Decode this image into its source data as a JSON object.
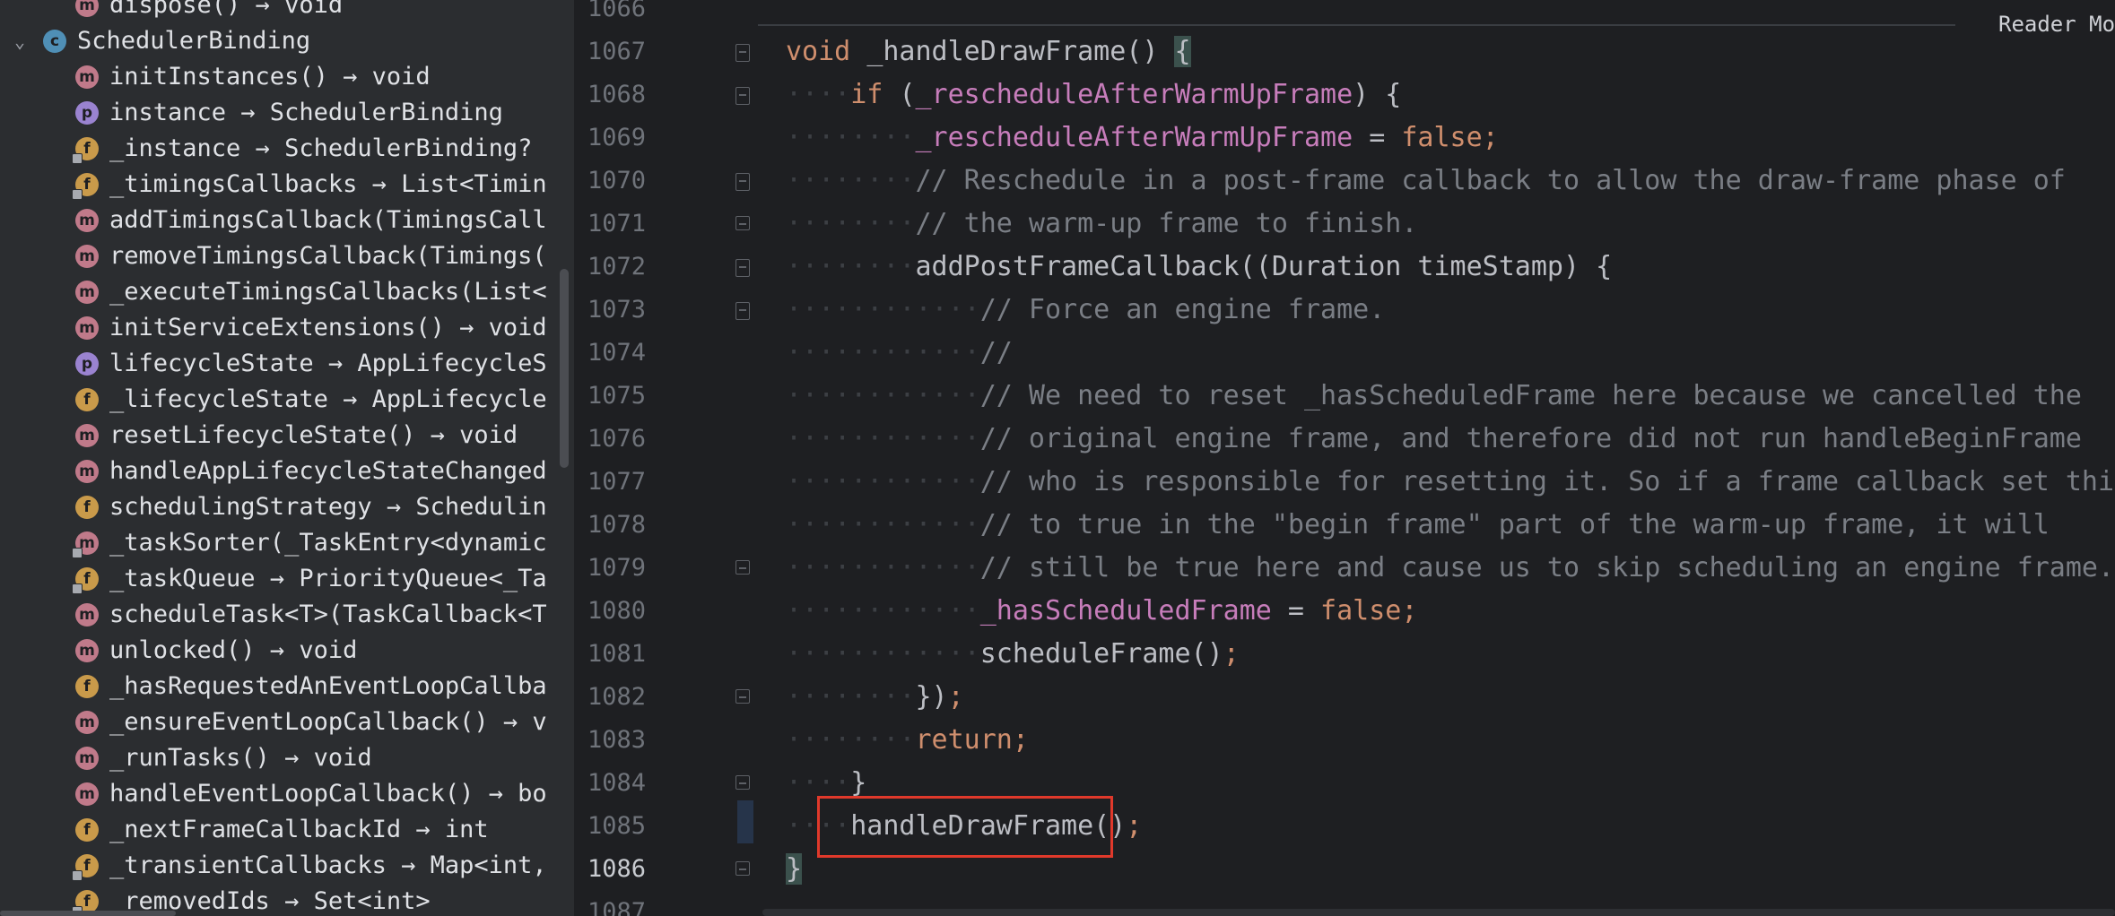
{
  "structure": {
    "rows": [
      {
        "kind": "m",
        "lock": false,
        "label": "dispose() → void"
      },
      {
        "kind": "c",
        "lock": false,
        "label": "SchedulerBinding",
        "expanded": true
      },
      {
        "kind": "m",
        "lock": false,
        "label": "initInstances() → void"
      },
      {
        "kind": "p",
        "lock": false,
        "label": "instance → SchedulerBinding"
      },
      {
        "kind": "f",
        "lock": true,
        "label": "_instance → SchedulerBinding?"
      },
      {
        "kind": "f",
        "lock": true,
        "label": "_timingsCallbacks → List<Timin"
      },
      {
        "kind": "m",
        "lock": false,
        "label": "addTimingsCallback(TimingsCall"
      },
      {
        "kind": "m",
        "lock": false,
        "label": "removeTimingsCallback(Timings("
      },
      {
        "kind": "m",
        "lock": false,
        "label": "_executeTimingsCallbacks(List<"
      },
      {
        "kind": "m",
        "lock": false,
        "label": "initServiceExtensions() → void"
      },
      {
        "kind": "p",
        "lock": false,
        "label": "lifecycleState → AppLifecycleS"
      },
      {
        "kind": "f",
        "lock": false,
        "label": "_lifecycleState → AppLifecycle"
      },
      {
        "kind": "m",
        "lock": false,
        "label": "resetLifecycleState() → void"
      },
      {
        "kind": "m",
        "lock": false,
        "label": "handleAppLifecycleStateChanged"
      },
      {
        "kind": "f",
        "lock": false,
        "label": "schedulingStrategy → Schedulin"
      },
      {
        "kind": "m",
        "lock": true,
        "label": "_taskSorter(_TaskEntry<dynamic"
      },
      {
        "kind": "f",
        "lock": true,
        "label": "_taskQueue → PriorityQueue<_Ta"
      },
      {
        "kind": "m",
        "lock": false,
        "label": "scheduleTask<T>(TaskCallback<T"
      },
      {
        "kind": "m",
        "lock": false,
        "label": "unlocked() → void"
      },
      {
        "kind": "f",
        "lock": false,
        "label": "_hasRequestedAnEventLoopCallba"
      },
      {
        "kind": "m",
        "lock": false,
        "label": "_ensureEventLoopCallback() → v"
      },
      {
        "kind": "m",
        "lock": false,
        "label": "_runTasks() → void"
      },
      {
        "kind": "m",
        "lock": false,
        "label": "handleEventLoopCallback() → bo"
      },
      {
        "kind": "f",
        "lock": false,
        "label": "_nextFrameCallbackId → int"
      },
      {
        "kind": "f",
        "lock": true,
        "label": "_transientCallbacks → Map<int,"
      },
      {
        "kind": "f",
        "lock": true,
        "label": "_removedIds → Set<int>"
      }
    ]
  },
  "editor": {
    "reader_mode": "Reader Mo",
    "line_numbers": [
      "1066",
      "1067",
      "1068",
      "1069",
      "1070",
      "1071",
      "1072",
      "1073",
      "1074",
      "1075",
      "1076",
      "1077",
      "1078",
      "1079",
      "1080",
      "1081",
      "1082",
      "1083",
      "1084",
      "1085",
      "1086",
      "1087"
    ],
    "current_line": "1086",
    "lines": [
      [],
      [
        [
          "kw",
          "void "
        ],
        [
          "ty",
          "_handleDrawFrame() "
        ],
        [
          "brace",
          "{"
        ]
      ],
      [
        [
          "ws",
          "····"
        ],
        [
          "kw",
          "if "
        ],
        [
          "ty",
          "("
        ],
        [
          "field",
          "_rescheduleAfterWarmUpFrame"
        ],
        [
          "ty",
          ") {"
        ]
      ],
      [
        [
          "ws",
          "········"
        ],
        [
          "field",
          "_rescheduleAfterWarmUpFrame"
        ],
        [
          "ty",
          " = "
        ],
        [
          "kw",
          "false;"
        ]
      ],
      [
        [
          "ws",
          "········"
        ],
        [
          "cmt",
          "// Reschedule in a post-frame callback to allow the draw-frame phase of"
        ]
      ],
      [
        [
          "ws",
          "········"
        ],
        [
          "cmt",
          "// the warm-up frame to finish."
        ]
      ],
      [
        [
          "ws",
          "········"
        ],
        [
          "ty",
          "addPostFrameCallback((Duration timeStamp) {"
        ]
      ],
      [
        [
          "ws",
          "············"
        ],
        [
          "cmt",
          "// Force an engine frame."
        ]
      ],
      [
        [
          "ws",
          "············"
        ],
        [
          "cmt",
          "//"
        ]
      ],
      [
        [
          "ws",
          "············"
        ],
        [
          "cmt",
          "// We need to reset _hasScheduledFrame here because we cancelled the"
        ]
      ],
      [
        [
          "ws",
          "············"
        ],
        [
          "cmt",
          "// original engine frame, and therefore did not run handleBeginFrame"
        ]
      ],
      [
        [
          "ws",
          "············"
        ],
        [
          "cmt",
          "// who is responsible for resetting it. So if a frame callback set this"
        ]
      ],
      [
        [
          "ws",
          "············"
        ],
        [
          "cmt",
          "// to true in the \"begin frame\" part of the warm-up frame, it will"
        ]
      ],
      [
        [
          "ws",
          "············"
        ],
        [
          "cmt",
          "// still be true here and cause us to skip scheduling an engine frame."
        ]
      ],
      [
        [
          "ws",
          "············"
        ],
        [
          "field",
          "_hasScheduledFrame"
        ],
        [
          "ty",
          " = "
        ],
        [
          "kw",
          "false;"
        ]
      ],
      [
        [
          "ws",
          "············"
        ],
        [
          "ty",
          "scheduleFrame()"
        ],
        [
          "kw",
          ";"
        ]
      ],
      [
        [
          "ws",
          "········"
        ],
        [
          "ty",
          "})"
        ],
        [
          "kw",
          ";"
        ]
      ],
      [
        [
          "ws",
          "········"
        ],
        [
          "kw",
          "return;"
        ]
      ],
      [
        [
          "ws",
          "····"
        ],
        [
          "ty",
          "}"
        ]
      ],
      [
        [
          "ws",
          "····"
        ],
        [
          "ty",
          "handleDrawFrame()"
        ],
        [
          "kw",
          ";"
        ]
      ],
      [
        [
          "brace",
          "}"
        ]
      ],
      []
    ]
  }
}
